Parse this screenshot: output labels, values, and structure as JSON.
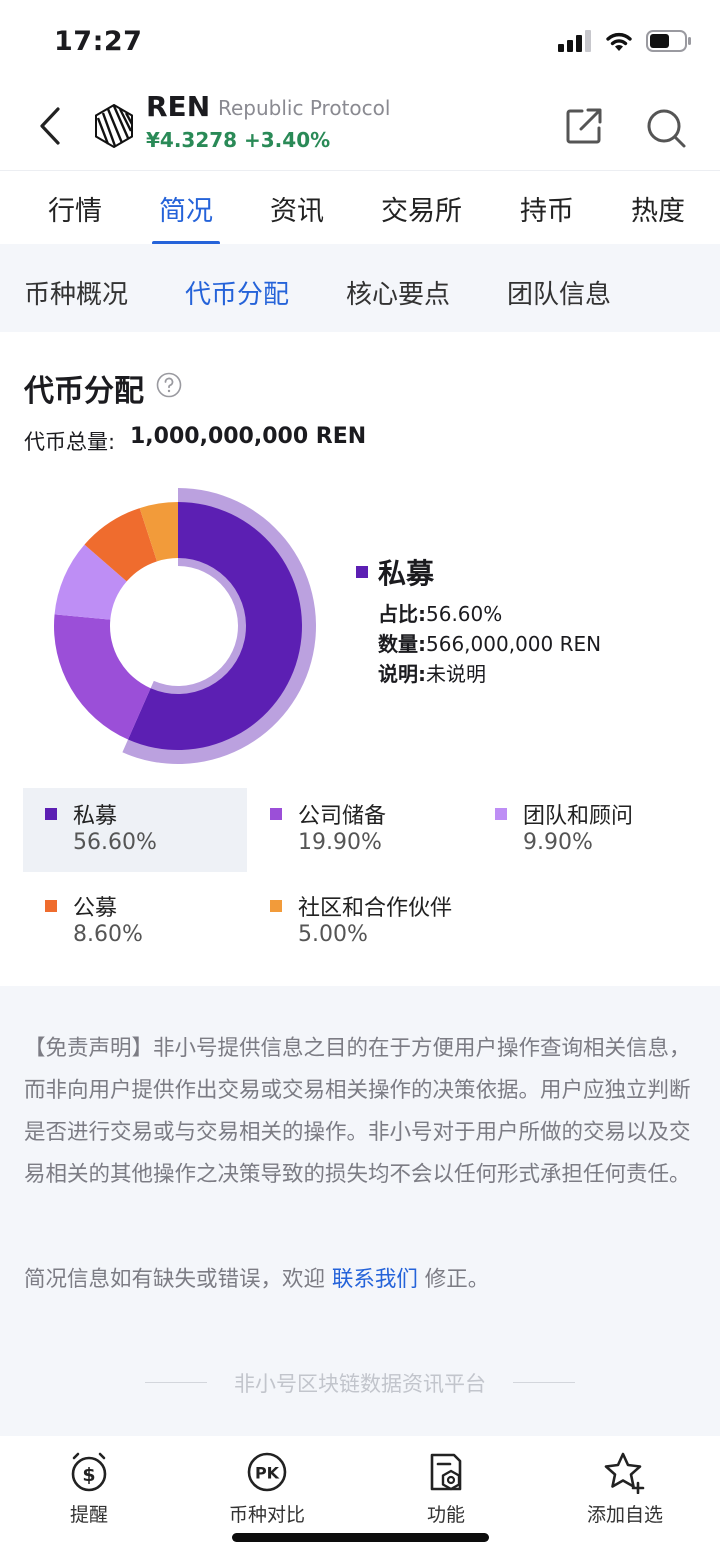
{
  "status": {
    "time": "17:27"
  },
  "header": {
    "symbol": "REN",
    "name": "Republic Protocol",
    "price": "¥4.3278",
    "change": "+3.40%"
  },
  "main_tabs": [
    {
      "label": "行情"
    },
    {
      "label": "简况"
    },
    {
      "label": "资讯"
    },
    {
      "label": "交易所"
    },
    {
      "label": "持币"
    },
    {
      "label": "热度"
    }
  ],
  "sub_tabs": [
    {
      "label": "币种概况"
    },
    {
      "label": "代币分配"
    },
    {
      "label": "核心要点"
    },
    {
      "label": "团队信息"
    }
  ],
  "distribution": {
    "title": "代币分配",
    "total_label": "代币总量:",
    "total_value": "1,000,000,000 REN",
    "selected": {
      "name": "私募",
      "ratio_label": "占比:",
      "ratio_value": "56.60%",
      "amount_label": "数量:",
      "amount_value": "566,000,000 REN",
      "note_label": "说明:",
      "note_value": "未说明"
    },
    "legend": [
      {
        "name": "私募",
        "pct": "56.60%",
        "color": "#5c1fb3"
      },
      {
        "name": "公司储备",
        "pct": "19.90%",
        "color": "#9b4fd8"
      },
      {
        "name": "团队和顾问",
        "pct": "9.90%",
        "color": "#be8ef5"
      },
      {
        "name": "公募",
        "pct": "8.60%",
        "color": "#ef6c2e"
      },
      {
        "name": "社区和合作伙伴",
        "pct": "5.00%",
        "color": "#f29b3a"
      }
    ]
  },
  "chart_data": {
    "type": "pie",
    "categories": [
      "私募",
      "公司储备",
      "团队和顾问",
      "公募",
      "社区和合作伙伴"
    ],
    "values": [
      56.6,
      19.9,
      9.9,
      8.6,
      5.0
    ],
    "highlighted": "私募"
  },
  "disclaimer": {
    "text": "【免责声明】非小号提供信息之目的在于方便用户操作查询相关信息，而非向用户提供作出交易或交易相关操作的决策依据。用户应独立判断是否进行交易或与交易相关的操作。非小号对于用户所做的交易以及交易相关的其他操作之决策导致的损失均不会以任何形式承担任何责任。",
    "contact_prefix": "简况信息如有缺失或错误，欢迎",
    "contact_link": "联系我们",
    "contact_suffix": "修正。",
    "brand": "非小号区块链数据资讯平台"
  },
  "bottom_bar": [
    {
      "label": "提醒",
      "icon": "alarm-dollar-icon"
    },
    {
      "label": "币种对比",
      "icon": "pk-icon"
    },
    {
      "label": "功能",
      "icon": "function-icon"
    },
    {
      "label": "添加自选",
      "icon": "star-add-icon"
    }
  ]
}
